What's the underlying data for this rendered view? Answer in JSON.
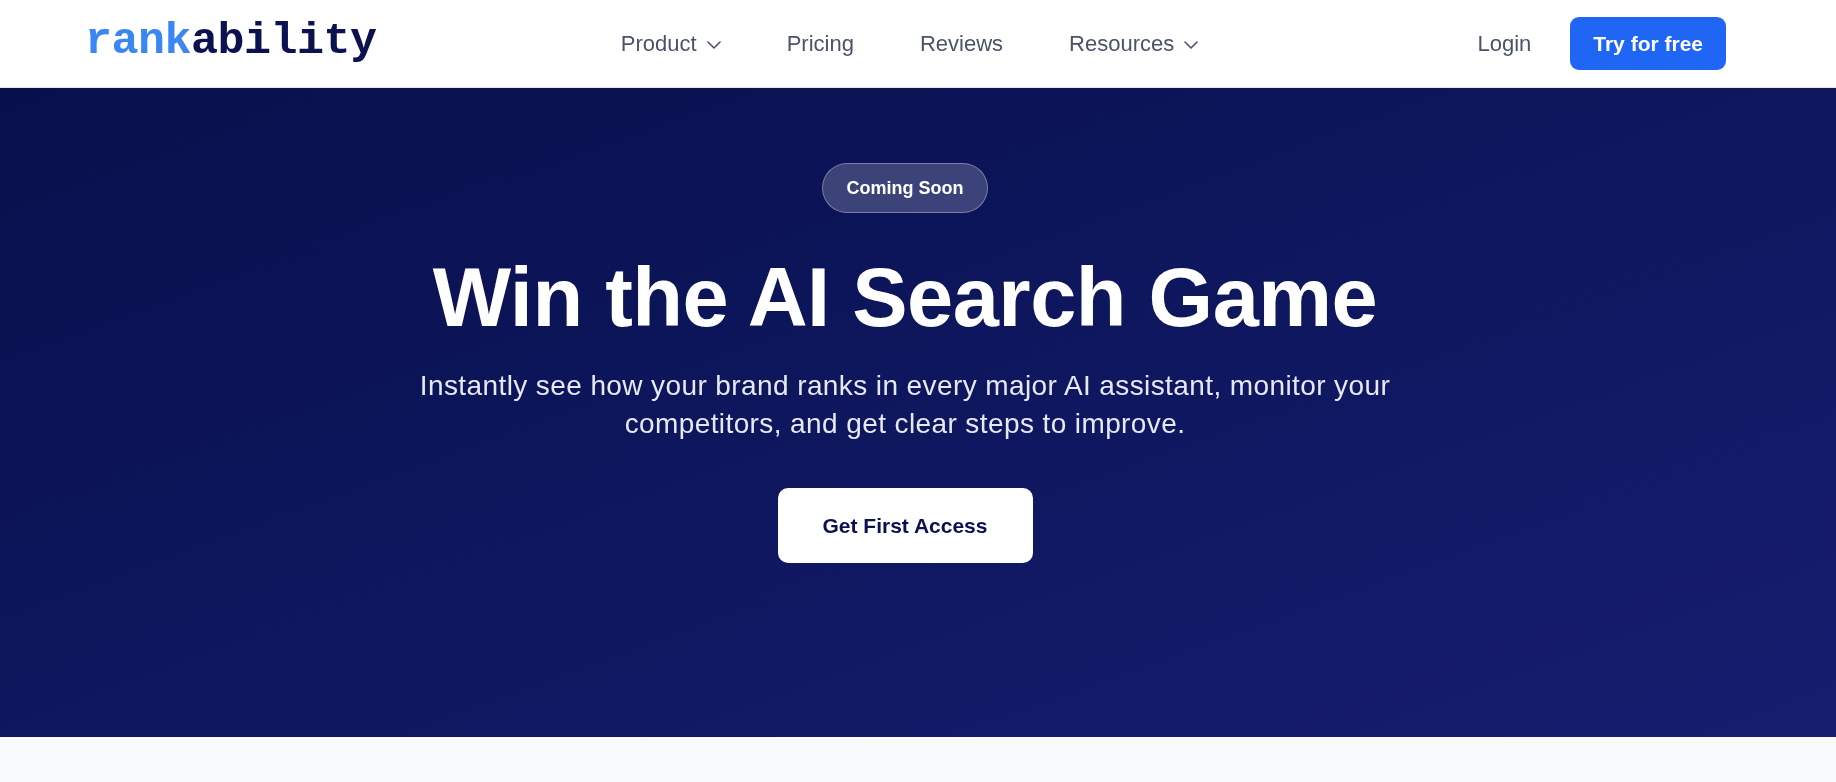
{
  "logo": {
    "parts": [
      {
        "text": "rank",
        "color": "#3b87f2"
      },
      {
        "text": "ability",
        "color": "#0c1250"
      }
    ]
  },
  "nav": {
    "items": [
      {
        "label": "Product",
        "dropdown": true
      },
      {
        "label": "Pricing",
        "dropdown": false
      },
      {
        "label": "Reviews",
        "dropdown": false
      },
      {
        "label": "Resources",
        "dropdown": true
      }
    ]
  },
  "actions": {
    "login": "Login",
    "cta": "Try for free"
  },
  "hero": {
    "badge": "Coming Soon",
    "title": "Win the AI Search Game",
    "subtitle": "Instantly see how your brand ranks in every major AI assistant, monitor your competitors, and get clear steps to improve.",
    "button": "Get First Access"
  }
}
